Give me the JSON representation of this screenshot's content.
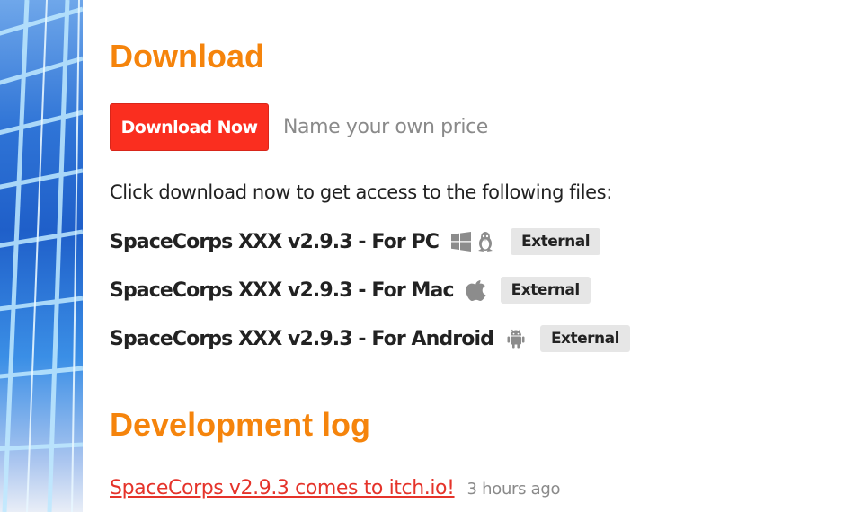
{
  "download": {
    "title": "Download",
    "button_label": "Download Now",
    "price_text": "Name your own price",
    "intro": "Click download now to get access to the following files:",
    "files": [
      {
        "name": "SpaceCorps XXX v2.9.3 - For PC",
        "icons": [
          "windows-icon",
          "linux-icon"
        ],
        "badge": "External"
      },
      {
        "name": "SpaceCorps XXX v2.9.3 - For Mac",
        "icons": [
          "apple-icon"
        ],
        "badge": "External"
      },
      {
        "name": "SpaceCorps XXX v2.9.3 - For Android",
        "icons": [
          "android-icon"
        ],
        "badge": "External"
      }
    ]
  },
  "devlog": {
    "title": "Development log",
    "entries": [
      {
        "title": "SpaceCorps v2.9.3 comes to itch.io!",
        "time": "3 hours ago"
      }
    ]
  },
  "colors": {
    "heading": "#f5840c",
    "button": "#fa2e1f",
    "link": "#e5332a",
    "badge_bg": "#e6e6e6"
  }
}
